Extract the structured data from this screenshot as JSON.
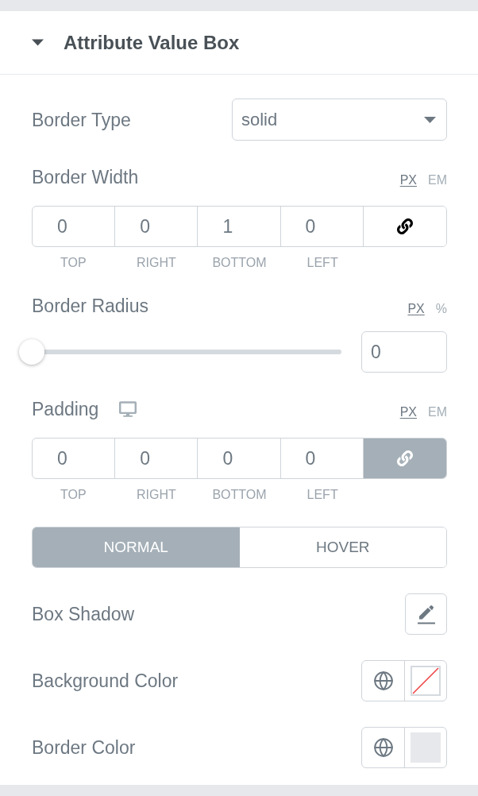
{
  "section": {
    "title": "Attribute Value Box",
    "expanded": true
  },
  "controls": [
    {
      "kind": "select",
      "label": "Border Type",
      "value": "solid"
    },
    {
      "kind": "dimensions",
      "label": "Border Width",
      "units": [
        {
          "label": "PX",
          "selected": true
        },
        {
          "label": "EM",
          "selected": false
        }
      ],
      "fields": [
        {
          "value": "0",
          "caption": "TOP"
        },
        {
          "value": "0",
          "caption": "RIGHT"
        },
        {
          "value": "1",
          "caption": "BOTTOM"
        },
        {
          "value": "0",
          "caption": "LEFT"
        }
      ],
      "linked": false
    },
    {
      "kind": "slider",
      "label": "Border Radius",
      "units": [
        {
          "label": "PX",
          "selected": true
        },
        {
          "label": "%",
          "selected": false
        }
      ],
      "level": 0,
      "value": "0"
    },
    {
      "kind": "dimensions",
      "label": "Padding",
      "responsive": true,
      "units": [
        {
          "label": "PX",
          "selected": true
        },
        {
          "label": "EM",
          "selected": false
        }
      ],
      "fields": [
        {
          "value": "0",
          "caption": "TOP"
        },
        {
          "value": "0",
          "caption": "RIGHT"
        },
        {
          "value": "0",
          "caption": "BOTTOM"
        },
        {
          "value": "0",
          "caption": "LEFT"
        }
      ],
      "linked": true
    },
    {
      "kind": "tabs",
      "tabs": [
        {
          "label": "NORMAL",
          "selected": true
        },
        {
          "label": "HOVER",
          "selected": false
        }
      ]
    },
    {
      "kind": "popover",
      "label": "Box Shadow"
    },
    {
      "kind": "color",
      "label": "Background Color",
      "empty": true
    },
    {
      "kind": "color",
      "label": "Border Color",
      "empty": false,
      "color": "#e6e8eb"
    }
  ]
}
